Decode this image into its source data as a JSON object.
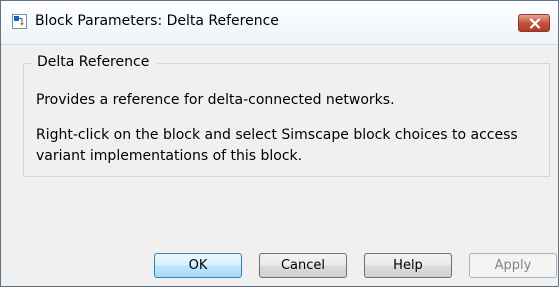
{
  "window": {
    "title": "Block Parameters: Delta Reference",
    "app_icon": "simulink-block-icon",
    "close_icon": "close-icon"
  },
  "group": {
    "legend": "Delta Reference",
    "description_line1": "Provides a reference for delta-connected networks.",
    "description_line2": "Right-click on the block and select Simscape block choices to access",
    "description_line3": "variant implementations of this block."
  },
  "buttons": {
    "ok": "OK",
    "cancel": "Cancel",
    "help": "Help",
    "apply": "Apply"
  },
  "colors": {
    "close_button": "#c3533d",
    "default_button_border": "#3c7fb1",
    "disabled_text": "#838383"
  }
}
